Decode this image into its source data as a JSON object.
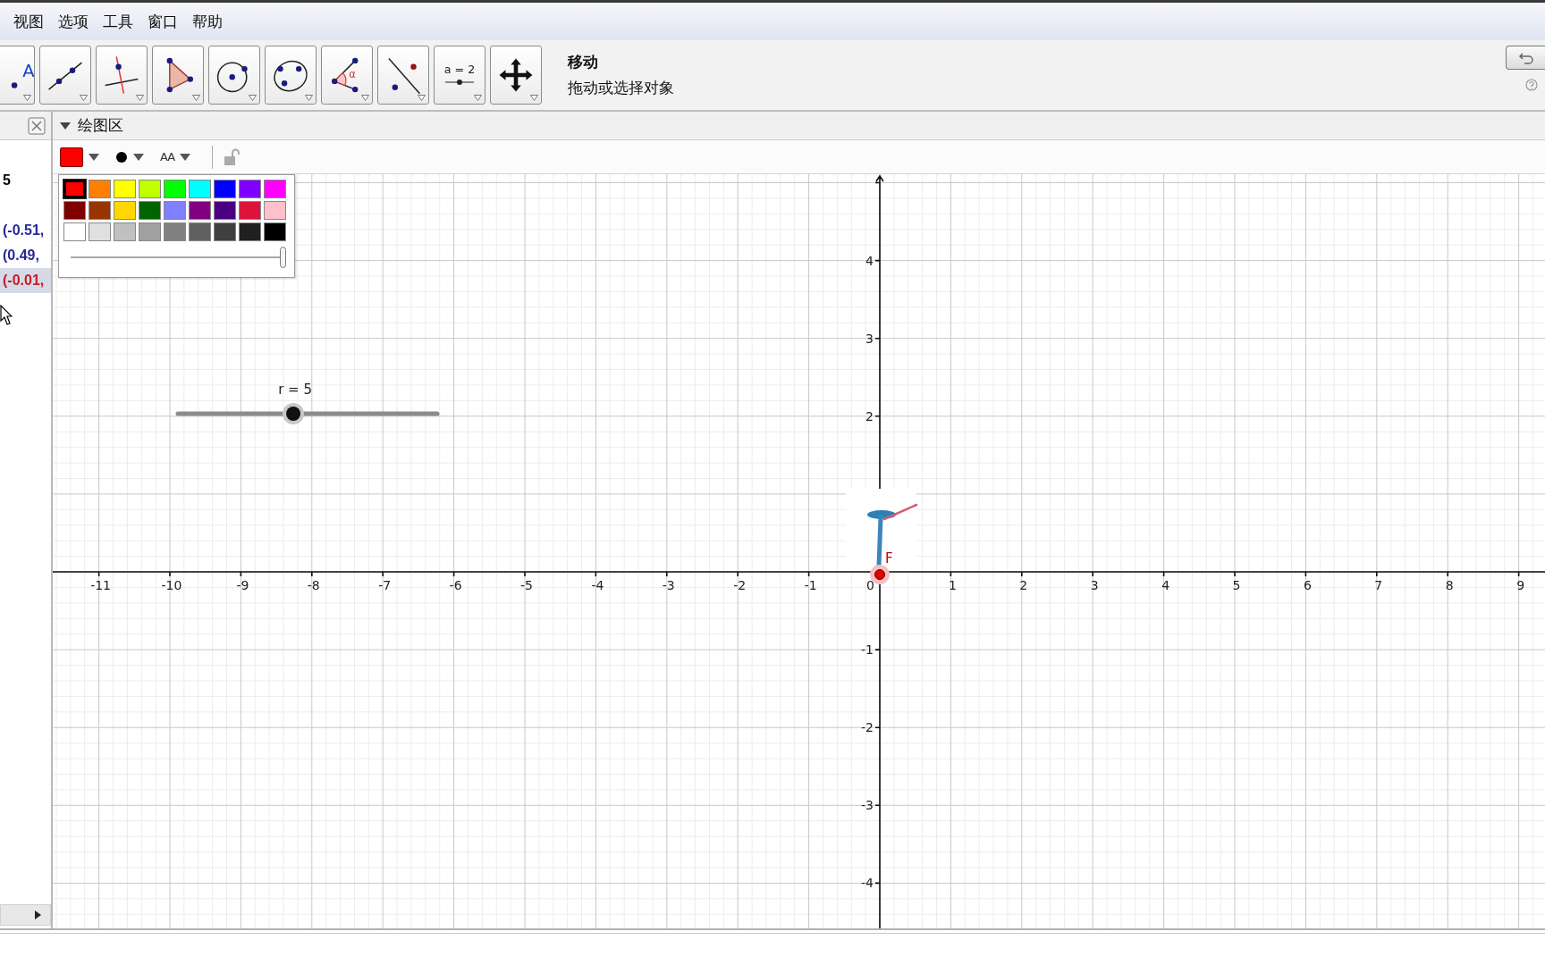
{
  "menu": [
    "视图",
    "选项",
    "工具",
    "窗口",
    "帮助"
  ],
  "toolbar": {
    "tools": [
      {
        "kind": "text",
        "label": "A"
      },
      {
        "kind": "line"
      },
      {
        "kind": "perpendicular"
      },
      {
        "kind": "polygon"
      },
      {
        "kind": "circle"
      },
      {
        "kind": "conic"
      },
      {
        "kind": "angle",
        "label": "α"
      },
      {
        "kind": "reflect"
      },
      {
        "kind": "slider",
        "label": "a = 2"
      },
      {
        "kind": "move"
      }
    ],
    "current_tool": {
      "name": "移动",
      "help": "拖动或选择对象"
    }
  },
  "algebra": {
    "items": [
      {
        "text": "5",
        "color": "#000000",
        "selected": false
      },
      {
        "text": "(-0.51,",
        "color": "#26289a",
        "selected": false
      },
      {
        "text": "(0.49,",
        "color": "#26289a",
        "selected": false
      },
      {
        "text": "(-0.01,",
        "color": "#c41e2a",
        "selected": true
      }
    ]
  },
  "graphics": {
    "title": "绘图区",
    "style_bar": {
      "color": "#ff0000",
      "text_style": "AA"
    },
    "palette": {
      "rows": [
        [
          {
            "color": "#ff0000",
            "selected": true
          },
          {
            "color": "#ff7f00",
            "selected": false
          },
          {
            "color": "#ffff00",
            "selected": false
          },
          {
            "color": "#bfff00",
            "selected": false
          },
          {
            "color": "#00ff00",
            "selected": false
          },
          {
            "color": "#00ffff",
            "selected": false
          },
          {
            "color": "#0000ff",
            "selected": false
          },
          {
            "color": "#7f00ff",
            "selected": false
          },
          {
            "color": "#ff00ff",
            "selected": false
          }
        ],
        [
          {
            "color": "#7f0000",
            "selected": false
          },
          {
            "color": "#993300",
            "selected": false
          },
          {
            "color": "#ffd700",
            "selected": false
          },
          {
            "color": "#006400",
            "selected": false
          },
          {
            "color": "#8080ff",
            "selected": false
          },
          {
            "color": "#800080",
            "selected": false
          },
          {
            "color": "#4b0082",
            "selected": false
          },
          {
            "color": "#dc143c",
            "selected": false
          },
          {
            "color": "#ffc0cb",
            "selected": false
          }
        ],
        [
          {
            "color": "#ffffff",
            "selected": false
          },
          {
            "color": "#e0e0e0",
            "selected": false
          },
          {
            "color": "#c0c0c0",
            "selected": false
          },
          {
            "color": "#a0a0a0",
            "selected": false
          },
          {
            "color": "#808080",
            "selected": false
          },
          {
            "color": "#606060",
            "selected": false
          },
          {
            "color": "#404040",
            "selected": false
          },
          {
            "color": "#202020",
            "selected": false
          },
          {
            "color": "#000000",
            "selected": false
          }
        ]
      ],
      "opacity": {
        "level": 1
      }
    },
    "axes": {
      "x_negative": [
        "-11",
        "-10",
        "-9",
        "-8",
        "-7",
        "-6",
        "-5",
        "-4",
        "-3",
        "-2",
        "-1"
      ],
      "x_positive": [
        "1",
        "2",
        "3",
        "4",
        "5",
        "6",
        "7",
        "8",
        "9"
      ],
      "origin": "0",
      "y_positive": [
        "4",
        "3",
        "2"
      ],
      "y_negative": [
        "-1",
        "-2",
        "-3",
        "-4"
      ]
    },
    "slider": {
      "label": "r = 5",
      "level": 0.445
    },
    "point": {
      "label": "F"
    }
  }
}
